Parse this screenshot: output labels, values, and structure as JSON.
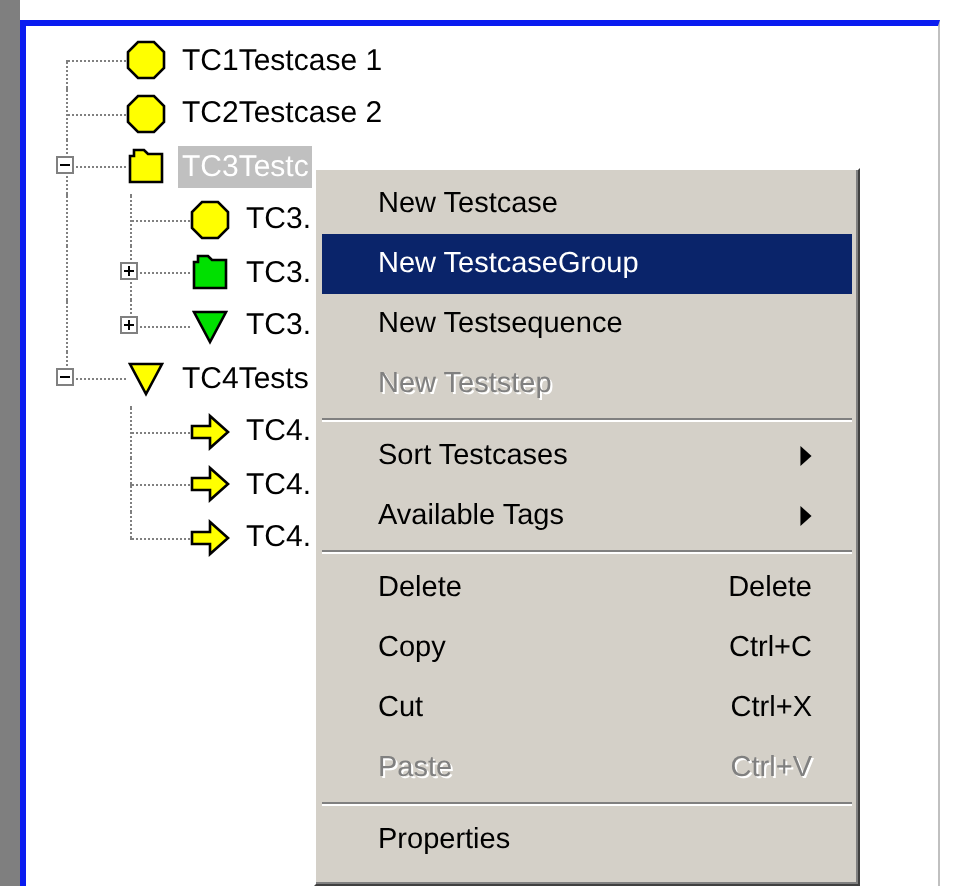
{
  "tree": [
    {
      "label": "TC1Testcase 1",
      "kind": "testcase",
      "color": "#ffff00",
      "selected": false
    },
    {
      "label": "TC2Testcase 2",
      "kind": "testcase",
      "color": "#ffff00",
      "selected": false
    },
    {
      "label": "TC3Testc",
      "kind": "group",
      "color": "#ffff00",
      "selected": true,
      "expanded": true,
      "children": [
        {
          "label": "TC3.",
          "kind": "testcase",
          "color": "#ffff00",
          "selected": false
        },
        {
          "label": "TC3.",
          "kind": "group",
          "color": "#00e000",
          "selected": false,
          "expanded": false
        },
        {
          "label": "TC3.",
          "kind": "sequence",
          "color": "#00e000",
          "selected": false,
          "expanded": false
        }
      ]
    },
    {
      "label": "TC4Tests",
      "kind": "sequence",
      "color": "#ffff00",
      "selected": false,
      "expanded": true,
      "children": [
        {
          "label": "TC4.",
          "kind": "step",
          "color": "#ffff00",
          "selected": false
        },
        {
          "label": "TC4.",
          "kind": "step",
          "color": "#ffff00",
          "selected": false
        },
        {
          "label": "TC4.",
          "kind": "step",
          "color": "#ffff00",
          "selected": false
        }
      ]
    }
  ],
  "context_menu": [
    {
      "kind": "item",
      "label": "New Testcase",
      "selected": false,
      "disabled": false
    },
    {
      "kind": "item",
      "label": "New TestcaseGroup",
      "selected": true,
      "disabled": false
    },
    {
      "kind": "item",
      "label": "New Testsequence",
      "selected": false,
      "disabled": false
    },
    {
      "kind": "item",
      "label": "New Teststep",
      "selected": false,
      "disabled": true
    },
    {
      "kind": "separator"
    },
    {
      "kind": "submenu",
      "label": "Sort Testcases",
      "selected": false,
      "disabled": false
    },
    {
      "kind": "submenu",
      "label": "Available Tags",
      "selected": false,
      "disabled": false
    },
    {
      "kind": "separator"
    },
    {
      "kind": "item",
      "label": "Delete",
      "shortcut": "Delete",
      "selected": false,
      "disabled": false
    },
    {
      "kind": "item",
      "label": "Copy",
      "shortcut": "Ctrl+C",
      "selected": false,
      "disabled": false
    },
    {
      "kind": "item",
      "label": "Cut",
      "shortcut": "Ctrl+X",
      "selected": false,
      "disabled": false
    },
    {
      "kind": "item",
      "label": "Paste",
      "shortcut": "Ctrl+V",
      "selected": false,
      "disabled": true
    },
    {
      "kind": "separator"
    },
    {
      "kind": "item",
      "label": "Properties",
      "selected": false,
      "disabled": false
    }
  ]
}
